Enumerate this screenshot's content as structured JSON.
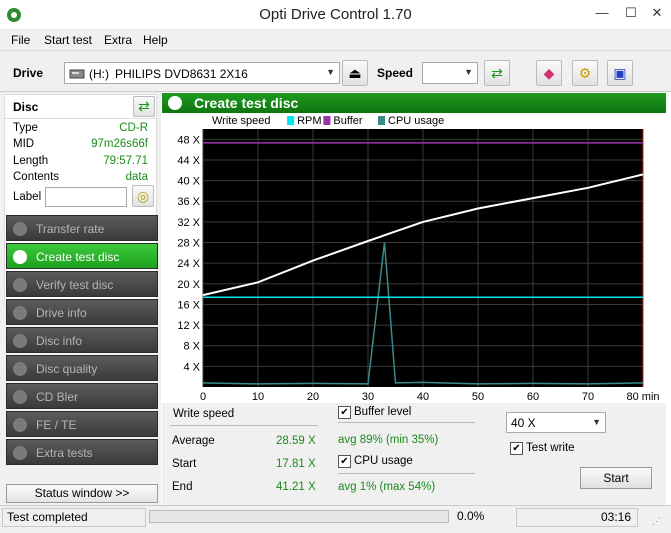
{
  "window": {
    "title": "Opti Drive Control 1.70",
    "minimize": "—",
    "maximize": "☐",
    "close": "✕"
  },
  "menu": [
    "File",
    "Start test",
    "Extra",
    "Help"
  ],
  "toolbar": {
    "drive_label": "Drive",
    "drive_letter": "(H:)",
    "drive_value": "PHILIPS DVD8631 2X16",
    "speed_label": "Speed",
    "speed_value": ""
  },
  "disc": {
    "header": "Disc",
    "type_label": "Type",
    "type_value": "CD-R",
    "mid_label": "MID",
    "mid_value": "97m26s66f",
    "length_label": "Length",
    "length_value": "79:57.71",
    "contents_label": "Contents",
    "contents_value": "data",
    "label_label": "Label",
    "label_value": ""
  },
  "nav": [
    "Transfer rate",
    "Create test disc",
    "Verify test disc",
    "Drive info",
    "Disc info",
    "Disc quality",
    "CD Bler",
    "FE / TE",
    "Extra tests"
  ],
  "nav_active": 1,
  "status_window_button": "Status window >>",
  "main_title": "Create test disc",
  "chart_data": {
    "type": "line",
    "legend": [
      {
        "name": "Write speed",
        "color": "#ffffff"
      },
      {
        "name": "RPM",
        "color": "#00e5ee"
      },
      {
        "name": "Buffer",
        "color": "#9933aa"
      },
      {
        "name": "CPU usage",
        "color": "#3a8a8a"
      }
    ],
    "x_ticks": [
      "0",
      "10",
      "20",
      "30",
      "40",
      "50",
      "60",
      "70",
      "80 min"
    ],
    "y_ticks": [
      "4 X",
      "8 X",
      "12 X",
      "16 X",
      "20 X",
      "24 X",
      "28 X",
      "32 X",
      "36 X",
      "40 X",
      "44 X",
      "48 X"
    ],
    "xlim": [
      0,
      80
    ],
    "ylim": [
      0,
      50
    ],
    "series": [
      {
        "name": "Write speed",
        "x": [
          0,
          10,
          20,
          30,
          40,
          50,
          60,
          70,
          80
        ],
        "values": [
          17.81,
          20.3,
          24.5,
          28.3,
          32.0,
          34.6,
          36.6,
          38.6,
          41.21
        ]
      },
      {
        "name": "RPM",
        "x": [
          0,
          80
        ],
        "values": [
          17.4,
          17.4
        ]
      },
      {
        "name": "Buffer",
        "x": [
          0,
          80
        ],
        "values": [
          47.3,
          47.3
        ]
      },
      {
        "name": "CPU usage",
        "x": [
          0,
          10,
          20,
          30,
          33,
          35,
          40,
          50,
          60,
          70,
          80
        ],
        "values": [
          0.8,
          0.6,
          0.7,
          0.6,
          28,
          0.8,
          0.9,
          0.6,
          0.7,
          0.6,
          0.8
        ]
      }
    ]
  },
  "stats": {
    "write_speed_label": "Write speed",
    "average_label": "Average",
    "average_value": "28.59 X",
    "start_label": "Start",
    "start_value": "17.81 X",
    "end_label": "End",
    "end_value": "41.21 X",
    "buffer_level_label": "Buffer level",
    "buffer_avg": "avg 89% (min 35%)",
    "cpu_usage_label": "CPU usage",
    "cpu_avg": "avg 1% (max 54%)",
    "speed_select_value": "40 X",
    "test_write_label": "Test write",
    "start_button": "Start"
  },
  "statusbar": {
    "status": "Test completed",
    "progress": "0.0%",
    "time": "03:16"
  }
}
